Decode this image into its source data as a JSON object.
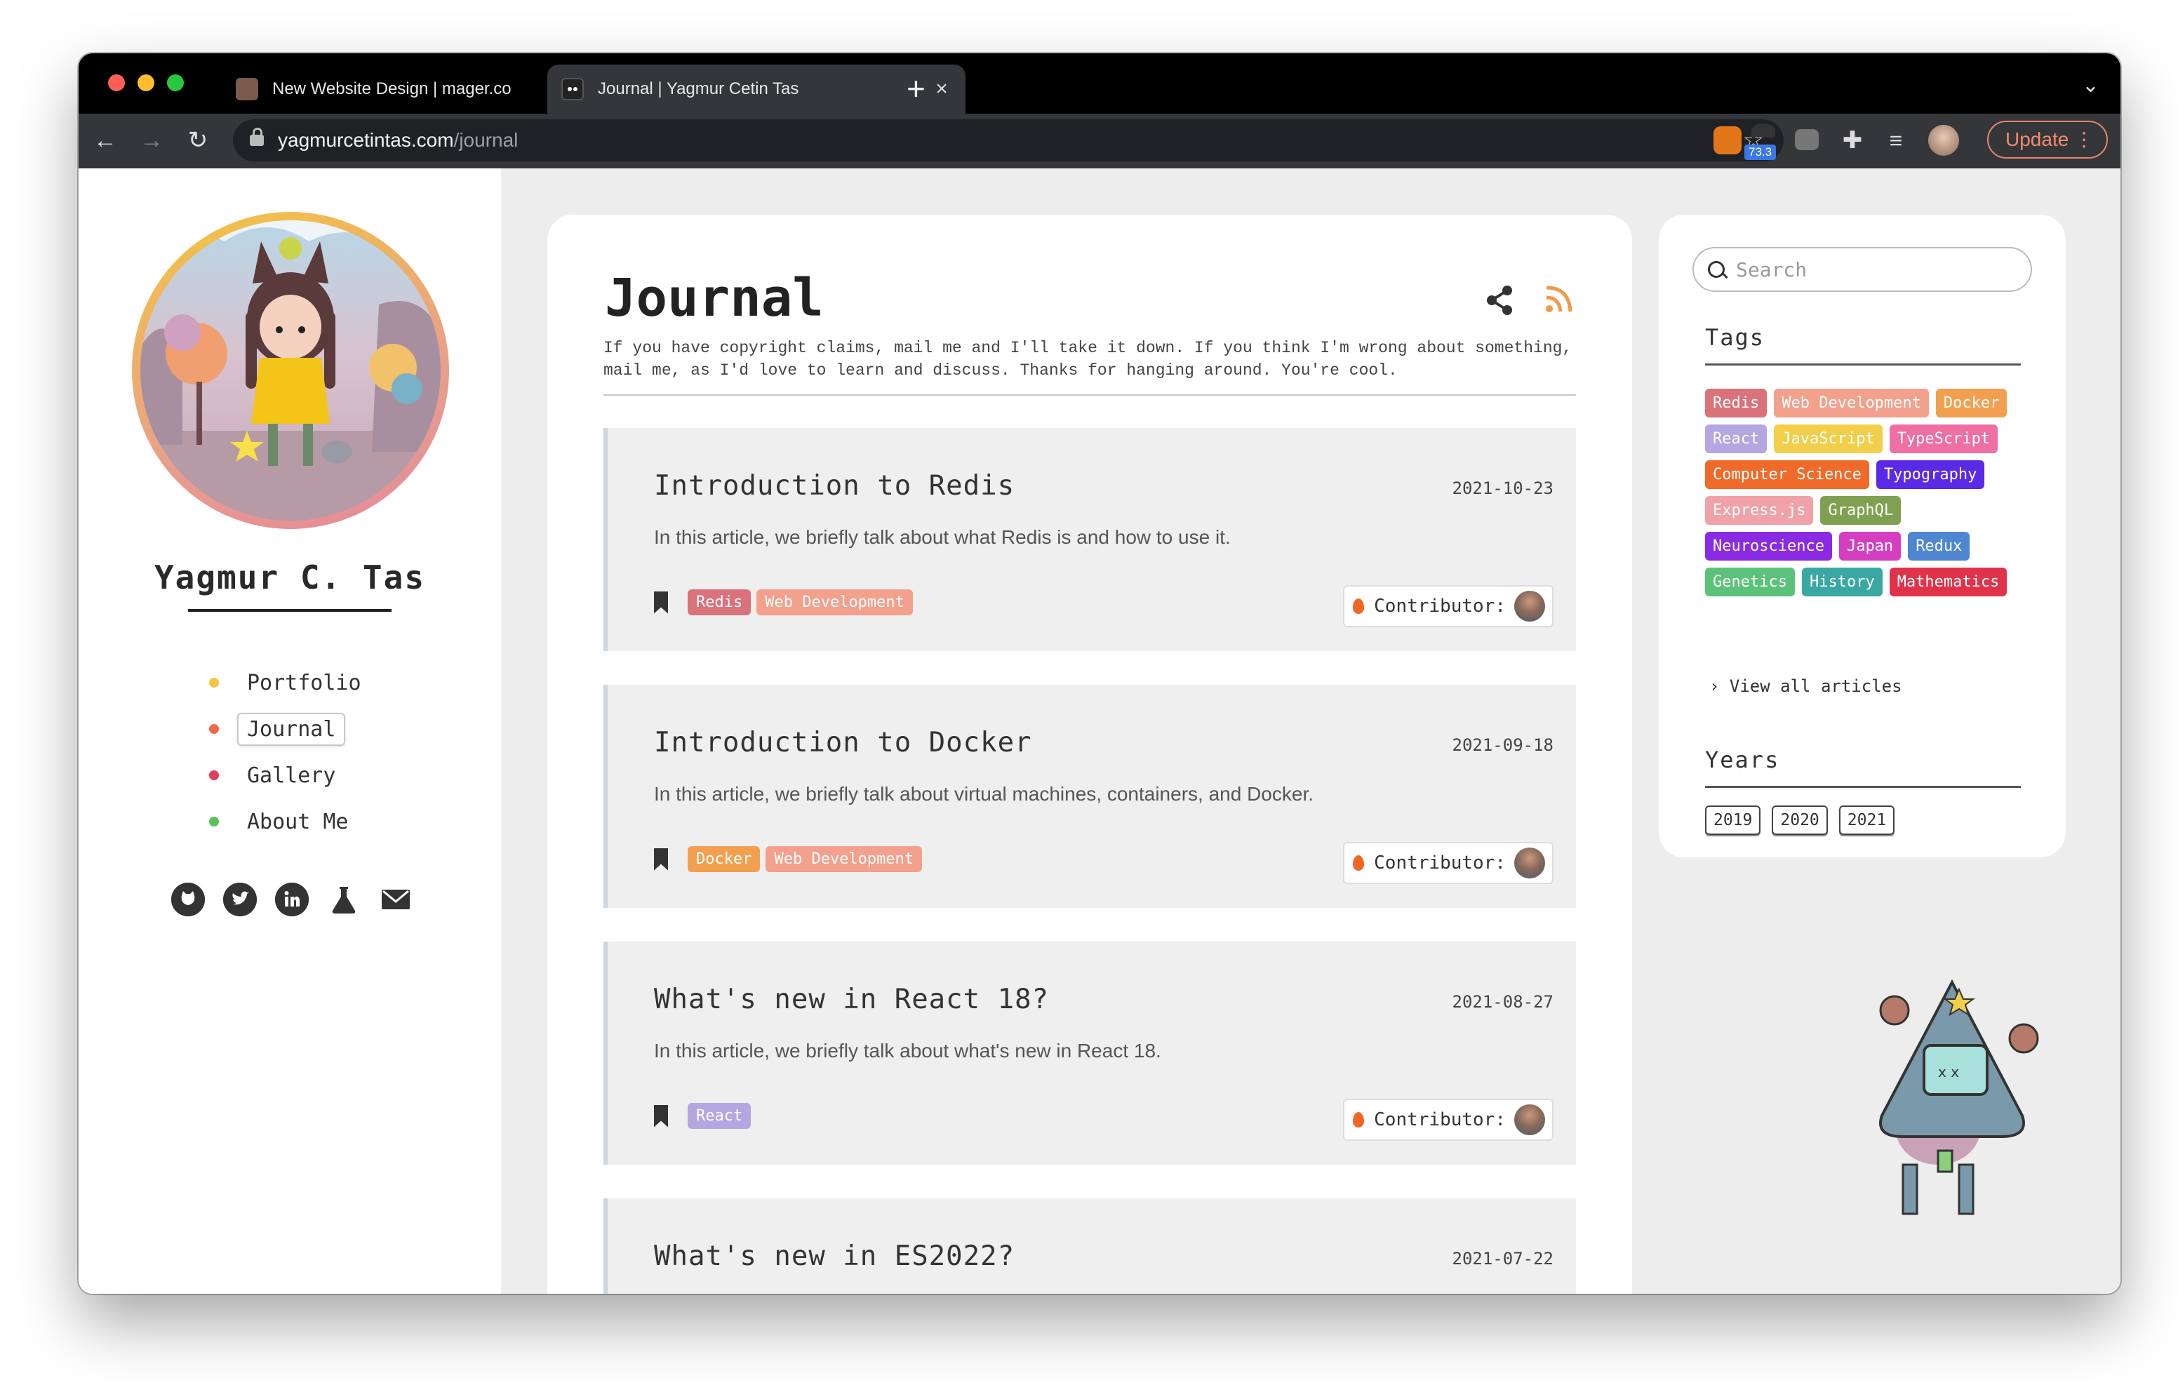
{
  "browser": {
    "tabs": [
      {
        "label": "New Website Design | mager.co",
        "active": false
      },
      {
        "label": "Journal | Yagmur Cetin Tas",
        "active": true
      }
    ],
    "url_host": "yagmurcetintas.com",
    "url_path": "/journal",
    "extension_badge": "73.3",
    "update_label": "Update"
  },
  "sidebar": {
    "name": "Yagmur C. Tas",
    "menu": [
      {
        "label": "Portfolio",
        "color": "#f3c63f"
      },
      {
        "label": "Journal",
        "color": "#ef6a4a",
        "active": true
      },
      {
        "label": "Gallery",
        "color": "#e33d5a"
      },
      {
        "label": "About Me",
        "color": "#57c25a"
      }
    ],
    "social_icons": [
      "github-icon",
      "twitter-icon",
      "linkedin-icon",
      "flask-icon",
      "mail-icon"
    ]
  },
  "journal": {
    "title": "Journal",
    "intro": "If you have copyright claims, mail me and I'll take it down. If you think I'm wrong about something, mail me, as I'd love to learn and discuss. Thanks for hanging around. You're cool.",
    "contributor_label": "Contributor:",
    "articles": [
      {
        "title": "Introduction to Redis",
        "date": "2021-10-23",
        "description": "In this article, we briefly talk about what Redis is and how to use it.",
        "tags": [
          "Redis",
          "Web Development"
        ]
      },
      {
        "title": "Introduction to Docker",
        "date": "2021-09-18",
        "description": "In this article, we briefly talk about virtual machines, containers, and Docker.",
        "tags": [
          "Docker",
          "Web Development"
        ]
      },
      {
        "title": "What's new in React 18?",
        "date": "2021-08-27",
        "description": "In this article, we briefly talk about what's new in React 18.",
        "tags": [
          "React"
        ]
      },
      {
        "title": "What's new in ES2022?",
        "date": "2021-07-22",
        "description": "",
        "tags": []
      }
    ]
  },
  "side": {
    "search_placeholder": "Search",
    "tags_heading": "Tags",
    "tags": [
      {
        "label": "Redis",
        "color": "#d9727a"
      },
      {
        "label": "Web Development",
        "color": "#f3a08c"
      },
      {
        "label": "Docker",
        "color": "#f2a050"
      },
      {
        "label": "React",
        "color": "#b4a6e0"
      },
      {
        "label": "JavaScript",
        "color": "#f2cf4a"
      },
      {
        "label": "TypeScript",
        "color": "#ee6fa3"
      },
      {
        "label": "Computer Science",
        "color": "#f06a2a"
      },
      {
        "label": "Typography",
        "color": "#5a2ae6"
      },
      {
        "label": "Express.js",
        "color": "#f0a2a8"
      },
      {
        "label": "GraphQL",
        "color": "#7fa050"
      },
      {
        "label": "Neuroscience",
        "color": "#8a2ae2"
      },
      {
        "label": "Japan",
        "color": "#d63ec2"
      },
      {
        "label": "Redux",
        "color": "#4f86d2"
      },
      {
        "label": "Genetics",
        "color": "#5cc27a"
      },
      {
        "label": "History",
        "color": "#3aa8a2"
      },
      {
        "label": "Mathematics",
        "color": "#e0334a"
      }
    ],
    "view_all": "View all articles",
    "years_heading": "Years",
    "years": [
      "2019",
      "2020",
      "2021"
    ]
  }
}
